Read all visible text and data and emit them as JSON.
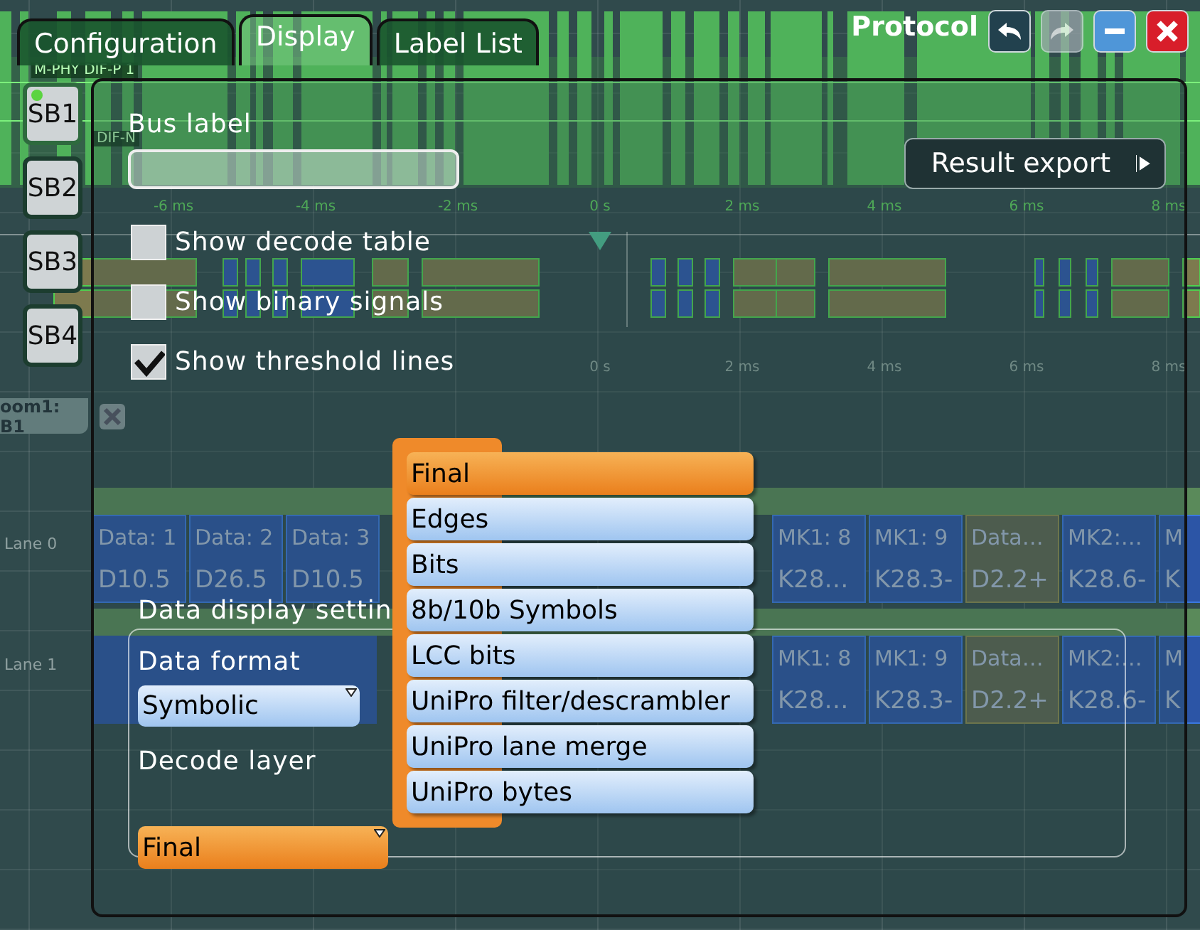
{
  "window": {
    "title": "Protocol"
  },
  "title_buttons": [
    {
      "kind": "undo",
      "disabled": false
    },
    {
      "kind": "redo",
      "disabled": true
    },
    {
      "kind": "minimize",
      "disabled": false
    },
    {
      "kind": "close",
      "disabled": false
    }
  ],
  "tabs": [
    {
      "label": "Configuration",
      "selected": false
    },
    {
      "label": "Display",
      "selected": true
    },
    {
      "label": "Label List",
      "selected": false
    }
  ],
  "bus_tabs": [
    {
      "label": "SB1",
      "selected": true
    },
    {
      "label": "SB2",
      "selected": false
    },
    {
      "label": "SB3",
      "selected": false
    },
    {
      "label": "SB4",
      "selected": false
    }
  ],
  "bus_label": {
    "label": "Bus label"
  },
  "result_export": {
    "label": "Result export"
  },
  "options": [
    {
      "label": "Show decode table",
      "checked": false
    },
    {
      "label": "Show binary signals",
      "checked": false
    },
    {
      "label": "Show threshold lines",
      "checked": true
    }
  ],
  "data_display_settings": {
    "title": "Data display settin",
    "data_format": {
      "label": "Data format",
      "value": "Symbolic"
    },
    "decode_layer": {
      "label": "Decode layer",
      "value": "Final"
    }
  },
  "decode_layer_menu": [
    {
      "label": "Final",
      "selected": true
    },
    {
      "label": "Edges",
      "selected": false
    },
    {
      "label": "Bits",
      "selected": false
    },
    {
      "label": "8b/10b Symbols",
      "selected": false
    },
    {
      "label": "LCC bits",
      "selected": false
    },
    {
      "label": "UniPro filter/descrambler",
      "selected": false
    },
    {
      "label": "UniPro lane merge",
      "selected": false
    },
    {
      "label": "UniPro bytes",
      "selected": false
    }
  ],
  "scope": {
    "channel_labels": [
      "M-PHY DIF-P 1",
      "DIF-N"
    ],
    "time_axis": [
      "-6 ms",
      "-4 ms",
      "-2 ms",
      "0 s",
      "2 ms",
      "4 ms",
      "6 ms",
      "8 ms"
    ],
    "time_axis_2": [
      "0 s",
      "2 ms",
      "4 ms",
      "6 ms",
      "8 ms"
    ],
    "zoom_tab": {
      "label": "oom1: B1"
    },
    "lanes": [
      {
        "label": "Lane 0",
        "cells_left": [
          {
            "label": "Data: 1",
            "value": "D10.5",
            "kind": "symbol"
          },
          {
            "label": "Data: 2",
            "value": "D26.5",
            "kind": "symbol"
          },
          {
            "label": "Data: 3",
            "value": "D10.5",
            "kind": "symbol"
          }
        ],
        "cells_right": [
          {
            "label": "MK1: 8",
            "value": "K28…",
            "kind": "symbol"
          },
          {
            "label": "MK1: 9",
            "value": "K28.3-",
            "kind": "symbol"
          },
          {
            "label": "Data…",
            "value": "D2.2+",
            "kind": "data"
          },
          {
            "label": "MK2:…",
            "value": "K28.6-",
            "kind": "symbol"
          },
          {
            "label": "M",
            "value": "K",
            "kind": "symbol"
          }
        ]
      },
      {
        "label": "Lane 1",
        "cells_right": [
          {
            "label": "MK1: 8",
            "value": "K28…",
            "kind": "symbol"
          },
          {
            "label": "MK1: 9",
            "value": "K28.3-",
            "kind": "symbol"
          },
          {
            "label": "Data…",
            "value": "D2.2+",
            "kind": "data"
          },
          {
            "label": "MK2:…",
            "value": "K28.6-",
            "kind": "symbol"
          },
          {
            "label": "M",
            "value": "K",
            "kind": "symbol"
          }
        ]
      }
    ]
  }
}
